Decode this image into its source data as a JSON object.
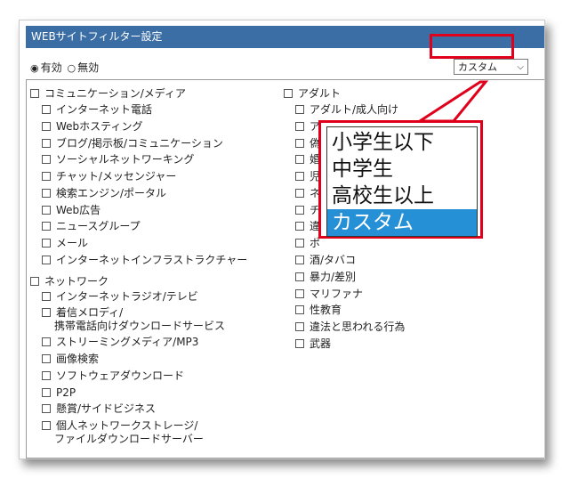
{
  "title": "WEBサイトフィルター設定",
  "status": {
    "enabled_label": "有効",
    "disabled_label": "無効",
    "enabled_selected": true
  },
  "level_select": {
    "value": "カスタム",
    "chevron": "chevron-down-icon"
  },
  "popup": {
    "options": [
      "小学生以下",
      "中学生",
      "高校生以上",
      "カスタム"
    ],
    "selected_index": 3
  },
  "left_column": {
    "groups": [
      {
        "label": "コミュニケーション/メディア",
        "items": [
          "インターネット電話",
          "Webホスティング",
          "ブログ/掲示板/コミュニケーション",
          "ソーシャルネットワーキング",
          "チャット/メッセンジャー",
          "検索エンジン/ポータル",
          "Web広告",
          "ニュースグループ",
          "メール",
          "インターネットインフラストラクチャー"
        ]
      },
      {
        "label": "ネットワーク",
        "items": [
          "インターネットラジオ/テレビ",
          "着信メロディ/",
          "携帯電話向けダウンロードサービス",
          "ストリーミングメディア/MP3",
          "画像検索",
          "ソフトウェアダウンロード",
          "P2P",
          "懸賞/サイドビジネス",
          "個人ネットワークストレージ/",
          "ファイルダウンロードサーバー"
        ]
      }
    ]
  },
  "right_column": {
    "groups": [
      {
        "label": "アダルト",
        "items": [
          "アダルト/成人向け",
          "ア",
          "偽",
          "婚",
          "児",
          "ネ",
          "チ",
          "違",
          "ポ",
          "酒/タバコ",
          "暴力/差別",
          "マリファナ",
          "性教育",
          "違法と思われる行為",
          "武器"
        ]
      }
    ]
  },
  "colors": {
    "title_bar": "#3a6ea5",
    "callout_red": "#e0001b",
    "selected_option": "#2690d6"
  }
}
